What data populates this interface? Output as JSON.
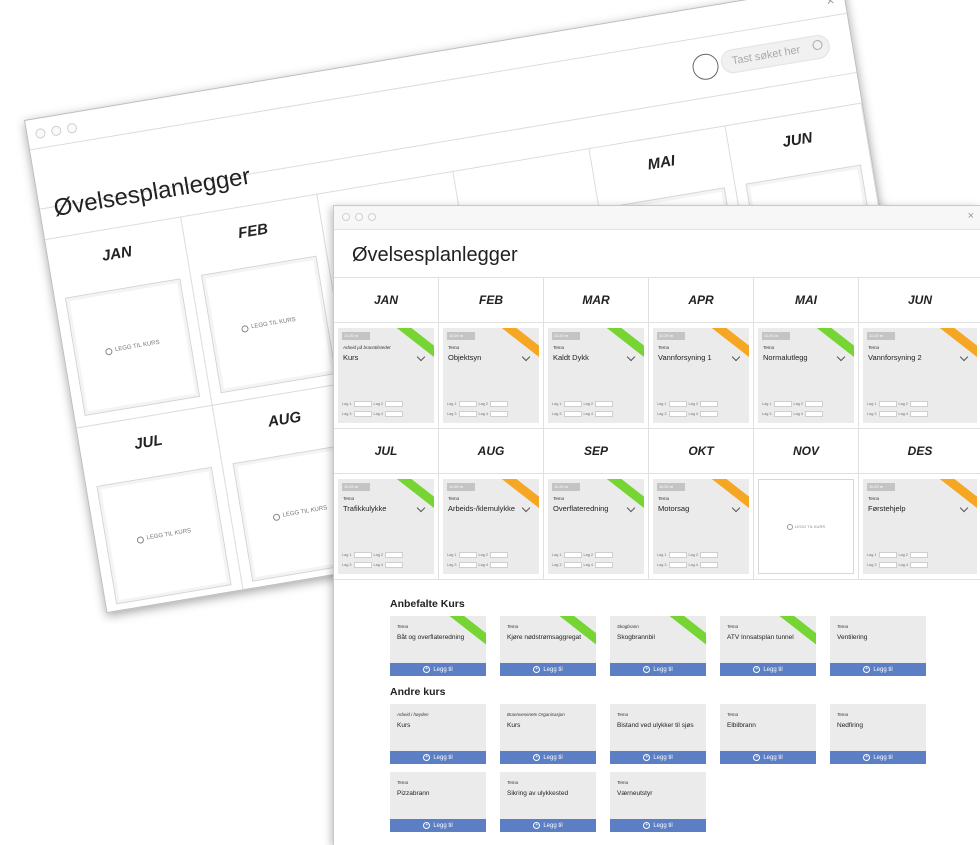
{
  "back_window": {
    "title": "Øvelsesplanlegger",
    "search_placeholder": "Tast søket her",
    "row1_months": [
      "JAN",
      "FEB",
      "",
      "",
      "MAI",
      "JUN"
    ],
    "row2_months": [
      "JUL",
      "AUG",
      "",
      "",
      "",
      ""
    ],
    "add_label": "LEGG TIL KURS",
    "close": "×"
  },
  "front_window": {
    "close": "×",
    "title": "Øvelsesplanlegger"
  },
  "months_row1": [
    {
      "month": "JAN",
      "tema": "Arbeid på branntilstedet",
      "name": "Kurs",
      "time": "11:20 m",
      "ribbon": "#76d433"
    },
    {
      "month": "FEB",
      "tema": "Tema",
      "name": "Objektsyn",
      "time": "11:20 m",
      "ribbon": "#f5a623"
    },
    {
      "month": "MAR",
      "tema": "Tema",
      "name": "Kaldt Dykk",
      "time": "11:20 m",
      "ribbon": "#76d433"
    },
    {
      "month": "APR",
      "tema": "Tema",
      "name": "Vannforsyning 1",
      "time": "11:20 m",
      "ribbon": "#f5a623"
    },
    {
      "month": "MAI",
      "tema": "Tema",
      "name": "Normalutlegg",
      "time": "11:20 m",
      "ribbon": "#76d433"
    },
    {
      "month": "JUN",
      "tema": "Tema",
      "name": "Vannforsyning 2",
      "time": "11:20 m",
      "ribbon": "#f5a623"
    }
  ],
  "months_row2": [
    {
      "month": "JUL",
      "tema": "Tema",
      "name": "Trafikkulykke",
      "time": "11:20 m",
      "ribbon": "#76d433"
    },
    {
      "month": "AUG",
      "tema": "Tema",
      "name": "Arbeids-/klemulykke",
      "time": "11:20 m",
      "ribbon": "#f5a623"
    },
    {
      "month": "SEP",
      "tema": "Tema",
      "name": "Overflateredning",
      "time": "11:20 m",
      "ribbon": "#76d433"
    },
    {
      "month": "OKT",
      "tema": "Tema",
      "name": "Motorsag",
      "time": "11:20 m",
      "ribbon": "#f5a623"
    },
    {
      "month": "NOV",
      "empty": true,
      "add_label": "LEGG TIL KURS"
    },
    {
      "month": "DES",
      "tema": "Tema",
      "name": "Førstehjelp",
      "time": "11:20 m",
      "ribbon": "#f5a623"
    }
  ],
  "card_logs": {
    "log1": "Lag 1",
    "log2": "Lag 2",
    "log3": "Lag 3",
    "log4": "Lag 4"
  },
  "anbefalte": {
    "title": "Anbefalte Kurs",
    "items": [
      {
        "tema": "Tema",
        "name": "Båt og overflateredning",
        "ribbon": true
      },
      {
        "tema": "Tema",
        "name": "Kjøre nødstrømsaggregat",
        "ribbon": true
      },
      {
        "tema": "Skogbrann",
        "name": "Skogbrannbil",
        "ribbon": true
      },
      {
        "tema": "Tema",
        "name": "ATV Innsatsplan tunnel",
        "ribbon": true
      },
      {
        "tema": "Tema",
        "name": "Ventilering",
        "ribbon": false
      }
    ],
    "button_label": "Legg til"
  },
  "andre": {
    "title": "Andre kurs",
    "row1": [
      {
        "tema": "Arbeid i høyden",
        "name": "Kurs"
      },
      {
        "tema": "Brannvesenets Organisasjon",
        "name": "Kurs"
      },
      {
        "tema": "Tema",
        "name": "Bistand ved ulykker til sjøs"
      },
      {
        "tema": "Tema",
        "name": "Elbilbrann"
      },
      {
        "tema": "Tema",
        "name": "Nedfiring"
      }
    ],
    "row2": [
      {
        "tema": "Tema",
        "name": "Pizzabrann"
      },
      {
        "tema": "Tema",
        "name": "Sikring av ulykkested"
      },
      {
        "tema": "Tema",
        "name": "Værneutstyr"
      }
    ],
    "button_label": "Legg til"
  }
}
